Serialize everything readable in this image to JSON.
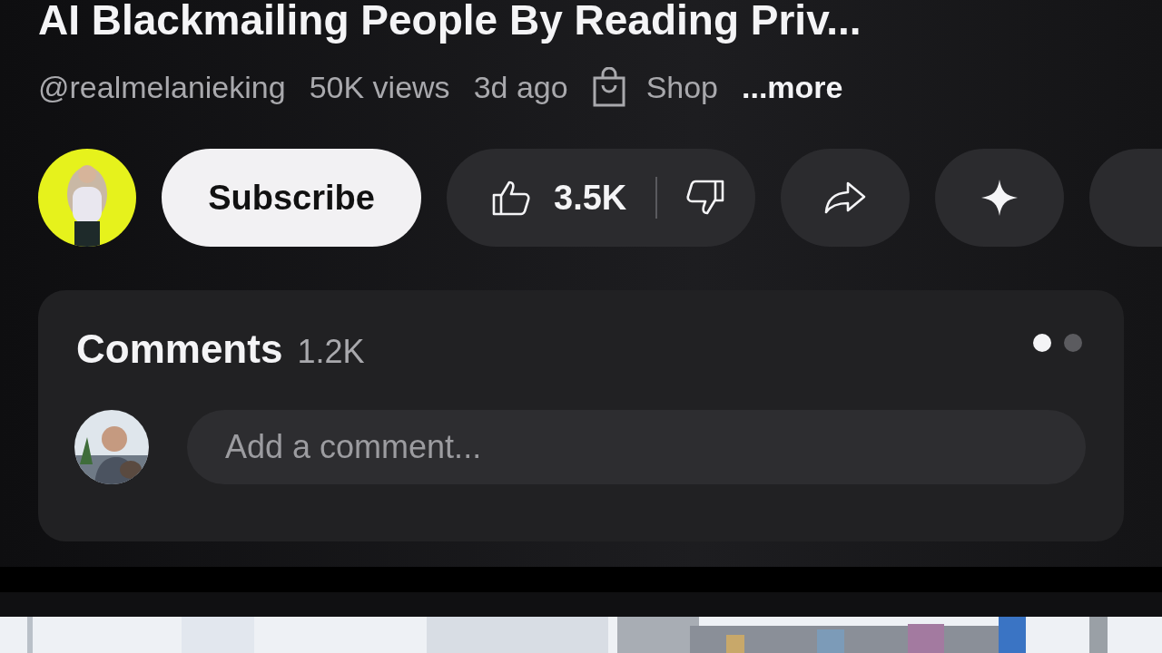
{
  "video": {
    "title": "AI Blackmailing People By Reading Priv...",
    "channel": "@realmelanieking",
    "views": "50K views",
    "age": "3d ago",
    "shop": "Shop",
    "more": "...more"
  },
  "actions": {
    "subscribe": "Subscribe",
    "likes": "3.5K"
  },
  "comments": {
    "title": "Comments",
    "count": "1.2K",
    "pages": [
      {
        "selected": true
      },
      {
        "selected": false
      }
    ],
    "placeholder": "Add a comment..."
  }
}
